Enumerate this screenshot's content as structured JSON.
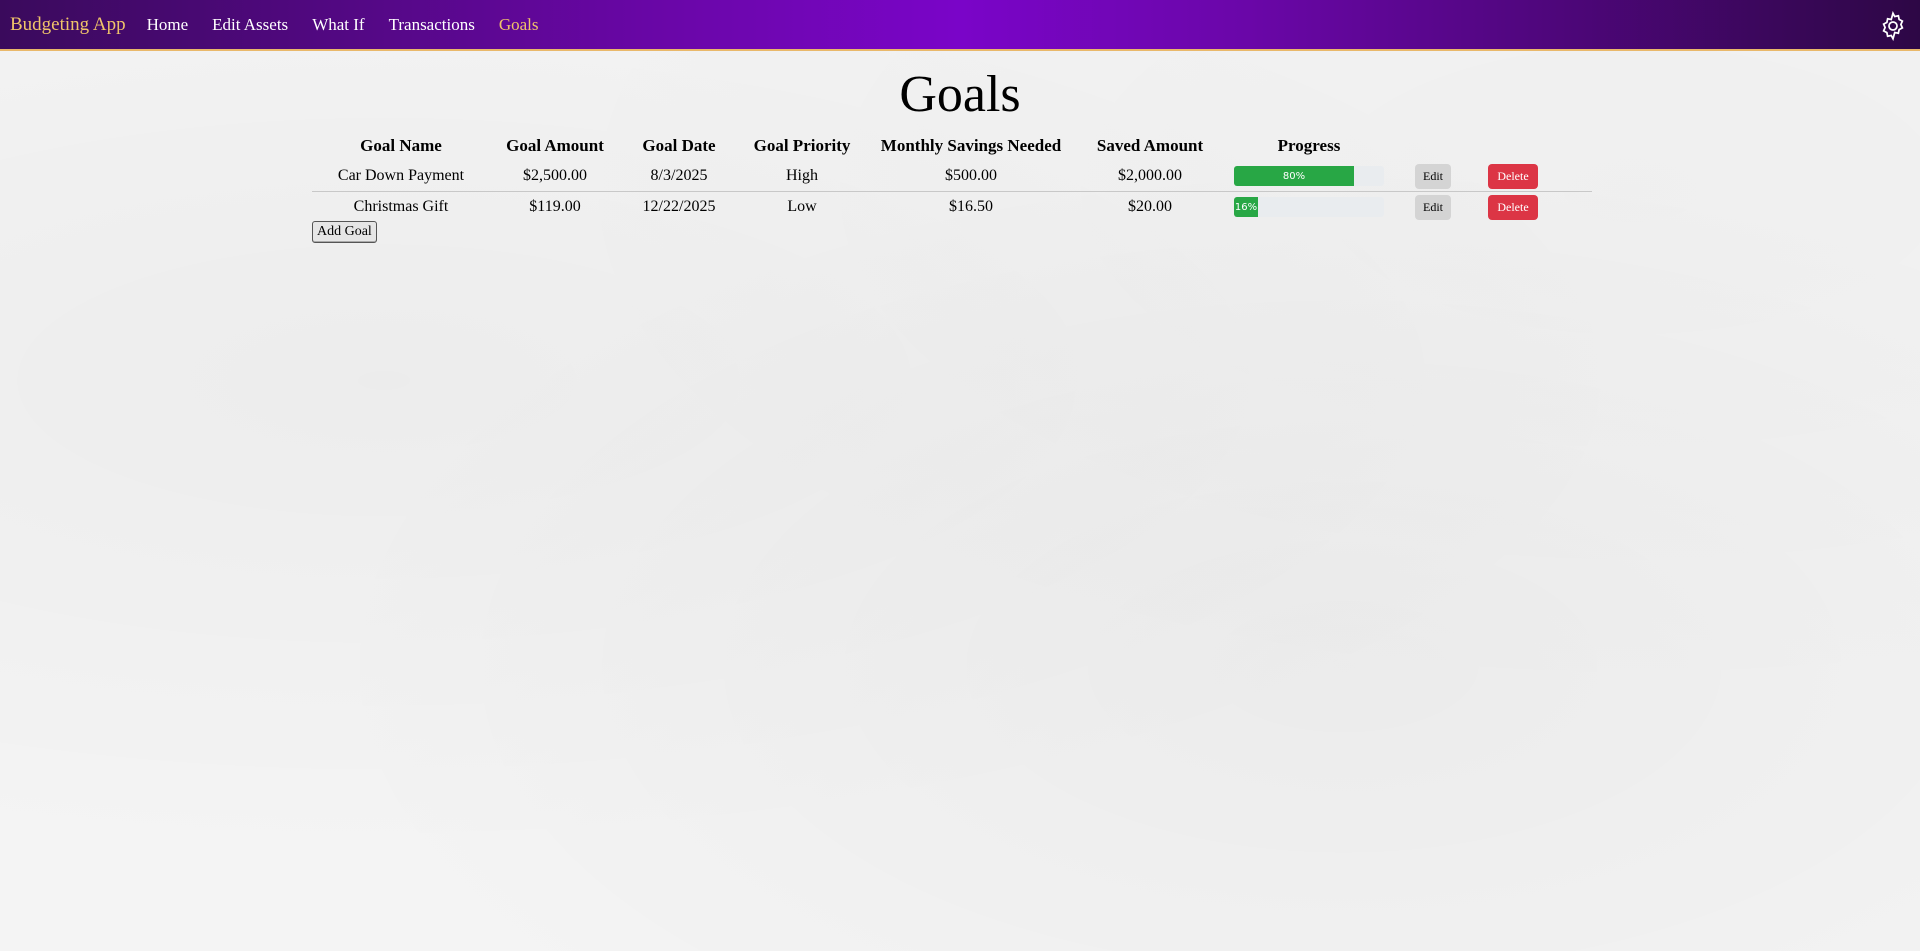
{
  "nav": {
    "brand": "Budgeting App",
    "links": [
      "Home",
      "Edit Assets",
      "What If",
      "Transactions",
      "Goals"
    ],
    "active": "Goals",
    "settings_icon": "gear-icon"
  },
  "page": {
    "title": "Goals"
  },
  "table": {
    "headers": [
      "Goal Name",
      "Goal Amount",
      "Goal Date",
      "Goal Priority",
      "Monthly Savings Needed",
      "Saved Amount",
      "Progress"
    ],
    "rows": [
      {
        "name": "Car Down Payment",
        "amount": "$2,500.00",
        "date": "8/3/2025",
        "priority": "High",
        "monthly": "$500.00",
        "saved": "$2,000.00",
        "progress_label": "80%",
        "progress_pct": 80,
        "edit": "Edit",
        "delete": "Delete"
      },
      {
        "name": "Christmas Gift",
        "amount": "$119.00",
        "date": "12/22/2025",
        "priority": "Low",
        "monthly": "$16.50",
        "saved": "$20.00",
        "progress_label": "16%",
        "progress_pct": 16,
        "edit": "Edit",
        "delete": "Delete"
      }
    ]
  },
  "actions": {
    "add_goal": "Add Goal"
  },
  "colors": {
    "nav_accent": "#f0c46a",
    "progress": "#28a745",
    "delete": "#dc3545"
  }
}
